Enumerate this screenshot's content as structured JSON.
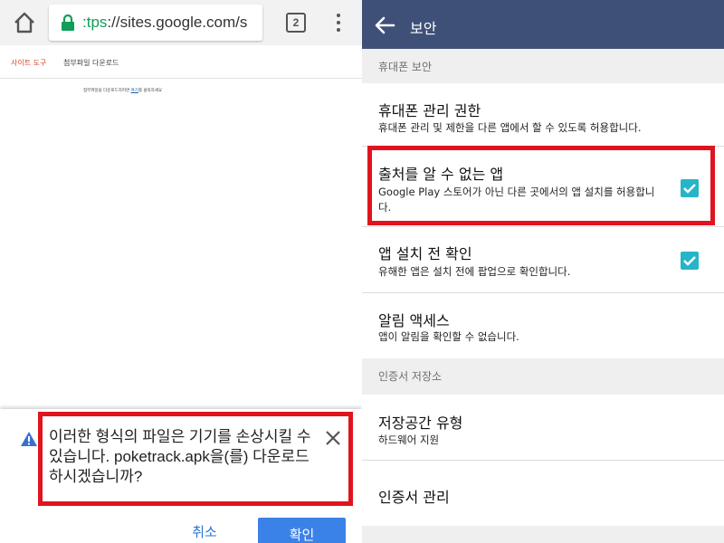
{
  "browser": {
    "url_scheme": ":tps",
    "url_host": "://sites.google.com/s",
    "tab_count": "2"
  },
  "site": {
    "tools_label": "사이트 도구",
    "tab_label": "첨부파일 다운로드",
    "message_prefix": "첨부파일을 다운로드하려면 ",
    "message_link": "여기",
    "message_suffix": "를 클릭하세요"
  },
  "download_warning": {
    "message": "이러한 형식의 파일은 기기를 손상시킬 수 있습니다. poketrack.apk을(를) 다운로드하시겠습니까?",
    "cancel_label": "취소",
    "confirm_label": "확인"
  },
  "settings": {
    "title": "보안",
    "sections": [
      {
        "header": "휴대폰 보안",
        "items": [
          {
            "title": "휴대폰 관리 권한",
            "subtitle": "휴대폰 관리 및 제한을 다른 앱에서 할 수 있도록 허용합니다."
          },
          {
            "title": "출처를 알 수 없는 앱",
            "subtitle": "Google Play 스토어가 아닌 다른 곳에서의 앱 설치를 허용합니다.",
            "checked": true
          },
          {
            "title": "앱 설치 전 확인",
            "subtitle": "유해한 앱은 설치 전에 팝업으로 확인합니다.",
            "checked": true
          },
          {
            "title": "알림 액세스",
            "subtitle": "앱이 알림을 확인할 수 없습니다."
          }
        ]
      },
      {
        "header": "인증서 저장소",
        "items": [
          {
            "title": "저장공간 유형",
            "subtitle": "하드웨어 지원"
          },
          {
            "title": "인증서 관리"
          }
        ]
      }
    ]
  },
  "colors": {
    "appbar": "#3f5078",
    "checkbox": "#26b5c8",
    "highlight": "#e0141e",
    "primary_button": "#3b82e8",
    "secure_lock": "#0f9d58"
  }
}
